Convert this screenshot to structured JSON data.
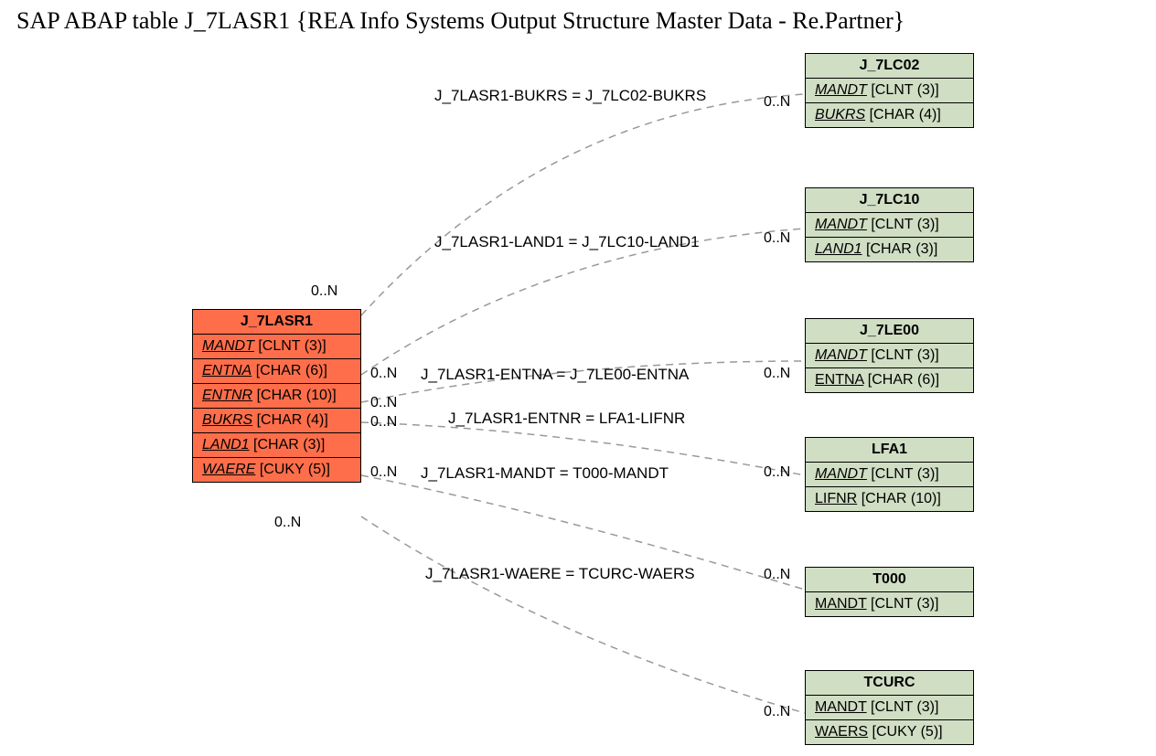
{
  "title": "SAP ABAP table J_7LASR1 {REA Info Systems Output Structure Master Data - Re.Partner}",
  "main": {
    "name": "J_7LASR1",
    "fields": [
      {
        "name": "MANDT",
        "type": "[CLNT (3)]"
      },
      {
        "name": "ENTNA",
        "type": "[CHAR (6)]"
      },
      {
        "name": "ENTNR",
        "type": "[CHAR (10)]"
      },
      {
        "name": "BUKRS",
        "type": "[CHAR (4)]"
      },
      {
        "name": "LAND1",
        "type": "[CHAR (3)]"
      },
      {
        "name": "WAERE",
        "type": "[CUKY (5)]"
      }
    ]
  },
  "rel": [
    {
      "name": "J_7LC02",
      "fields": [
        {
          "name": "MANDT",
          "type": "[CLNT (3)]",
          "italic": true
        },
        {
          "name": "BUKRS",
          "type": "[CHAR (4)]",
          "italic": true
        }
      ]
    },
    {
      "name": "J_7LC10",
      "fields": [
        {
          "name": "MANDT",
          "type": "[CLNT (3)]",
          "italic": true
        },
        {
          "name": "LAND1",
          "type": "[CHAR (3)]",
          "italic": true
        }
      ]
    },
    {
      "name": "J_7LE00",
      "fields": [
        {
          "name": "MANDT",
          "type": "[CLNT (3)]",
          "italic": true
        },
        {
          "name": "ENTNA",
          "type": "[CHAR (6)]",
          "italic": false
        }
      ]
    },
    {
      "name": "LFA1",
      "fields": [
        {
          "name": "MANDT",
          "type": "[CLNT (3)]",
          "italic": true
        },
        {
          "name": "LIFNR",
          "type": "[CHAR (10)]",
          "italic": false
        }
      ]
    },
    {
      "name": "T000",
      "fields": [
        {
          "name": "MANDT",
          "type": "[CLNT (3)]",
          "italic": false
        }
      ]
    },
    {
      "name": "TCURC",
      "fields": [
        {
          "name": "MANDT",
          "type": "[CLNT (3)]",
          "italic": false
        },
        {
          "name": "WAERS",
          "type": "[CUKY (5)]",
          "italic": false
        }
      ]
    }
  ],
  "edges": [
    {
      "label": "J_7LASR1-BUKRS = J_7LC02-BUKRS"
    },
    {
      "label": "J_7LASR1-LAND1 = J_7LC10-LAND1"
    },
    {
      "label": "J_7LASR1-ENTNA = J_7LE00-ENTNA"
    },
    {
      "label": "J_7LASR1-ENTNR = LFA1-LIFNR"
    },
    {
      "label": "J_7LASR1-MANDT = T000-MANDT"
    },
    {
      "label": "J_7LASR1-WAERE = TCURC-WAERS"
    }
  ],
  "card": "0..N"
}
